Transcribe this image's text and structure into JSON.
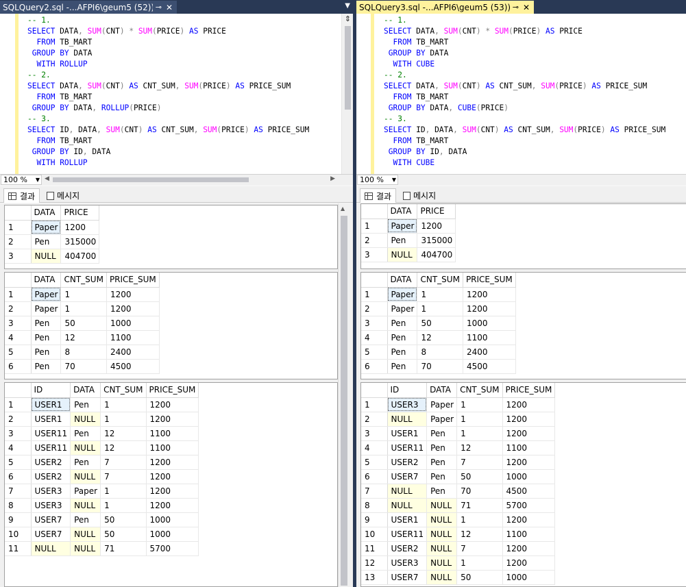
{
  "left": {
    "tab_title": "SQLQuery2.sql -...AFPI6\\geum5 (52))*",
    "pin_glyph": "⊸",
    "close_glyph": "✕",
    "zoom": "100 %",
    "results_tab": "결과",
    "messages_tab": "메시지",
    "code": [
      "-- 1.",
      "SELECT DATA, SUM(CNT) * SUM(PRICE) AS PRICE",
      "  FROM TB_MART",
      " GROUP BY DATA",
      "  WITH ROLLUP",
      "-- 2.",
      "SELECT DATA, SUM(CNT) AS CNT_SUM, SUM(PRICE) AS PRICE_SUM",
      "  FROM TB_MART",
      " GROUP BY DATA, ROLLUP(PRICE)",
      "-- 3.",
      "SELECT ID, DATA, SUM(CNT) AS CNT_SUM, SUM(PRICE) AS PRICE_SUM",
      "  FROM TB_MART",
      " GROUP BY ID, DATA",
      "  WITH ROLLUP"
    ],
    "grids": [
      {
        "columns": [
          "DATA",
          "PRICE"
        ],
        "rows": [
          [
            "1",
            "Paper",
            "1200"
          ],
          [
            "2",
            "Pen",
            "315000"
          ],
          [
            "3",
            "NULL",
            "404700"
          ]
        ]
      },
      {
        "columns": [
          "DATA",
          "CNT_SUM",
          "PRICE_SUM"
        ],
        "rows": [
          [
            "1",
            "Paper",
            "1",
            "1200"
          ],
          [
            "2",
            "Paper",
            "1",
            "1200"
          ],
          [
            "3",
            "Pen",
            "50",
            "1000"
          ],
          [
            "4",
            "Pen",
            "12",
            "1100"
          ],
          [
            "5",
            "Pen",
            "8",
            "2400"
          ],
          [
            "6",
            "Pen",
            "70",
            "4500"
          ]
        ]
      },
      {
        "columns": [
          "ID",
          "DATA",
          "CNT_SUM",
          "PRICE_SUM"
        ],
        "rows": [
          [
            "1",
            "USER1",
            "Pen",
            "1",
            "1200"
          ],
          [
            "2",
            "USER1",
            "NULL",
            "1",
            "1200"
          ],
          [
            "3",
            "USER11",
            "Pen",
            "12",
            "1100"
          ],
          [
            "4",
            "USER11",
            "NULL",
            "12",
            "1100"
          ],
          [
            "5",
            "USER2",
            "Pen",
            "7",
            "1200"
          ],
          [
            "6",
            "USER2",
            "NULL",
            "7",
            "1200"
          ],
          [
            "7",
            "USER3",
            "Paper",
            "1",
            "1200"
          ],
          [
            "8",
            "USER3",
            "NULL",
            "1",
            "1200"
          ],
          [
            "9",
            "USER7",
            "Pen",
            "50",
            "1000"
          ],
          [
            "10",
            "USER7",
            "NULL",
            "50",
            "1000"
          ],
          [
            "11",
            "NULL",
            "NULL",
            "71",
            "5700"
          ]
        ]
      }
    ]
  },
  "right": {
    "tab_title": "SQLQuery3.sql -...AFPI6\\geum5 (53))*",
    "pin_glyph": "⊸",
    "close_glyph": "✕",
    "zoom": "100 %",
    "results_tab": "결과",
    "messages_tab": "메시지",
    "code": [
      "-- 1.",
      "SELECT DATA, SUM(CNT) * SUM(PRICE) AS PRICE",
      "  FROM TB_MART",
      " GROUP BY DATA",
      "  WITH CUBE",
      "-- 2.",
      "SELECT DATA, SUM(CNT) AS CNT_SUM, SUM(PRICE) AS PRICE_SUM",
      "  FROM TB_MART",
      " GROUP BY DATA, CUBE(PRICE)",
      "-- 3.",
      "SELECT ID, DATA, SUM(CNT) AS CNT_SUM, SUM(PRICE) AS PRICE_SUM",
      "  FROM TB_MART",
      " GROUP BY ID, DATA",
      "  WITH CUBE"
    ],
    "grids": [
      {
        "columns": [
          "DATA",
          "PRICE"
        ],
        "rows": [
          [
            "1",
            "Paper",
            "1200"
          ],
          [
            "2",
            "Pen",
            "315000"
          ],
          [
            "3",
            "NULL",
            "404700"
          ]
        ]
      },
      {
        "columns": [
          "DATA",
          "CNT_SUM",
          "PRICE_SUM"
        ],
        "rows": [
          [
            "1",
            "Paper",
            "1",
            "1200"
          ],
          [
            "2",
            "Paper",
            "1",
            "1200"
          ],
          [
            "3",
            "Pen",
            "50",
            "1000"
          ],
          [
            "4",
            "Pen",
            "12",
            "1100"
          ],
          [
            "5",
            "Pen",
            "8",
            "2400"
          ],
          [
            "6",
            "Pen",
            "70",
            "4500"
          ]
        ]
      },
      {
        "columns": [
          "ID",
          "DATA",
          "CNT_SUM",
          "PRICE_SUM"
        ],
        "rows": [
          [
            "1",
            "USER3",
            "Paper",
            "1",
            "1200"
          ],
          [
            "2",
            "NULL",
            "Paper",
            "1",
            "1200"
          ],
          [
            "3",
            "USER1",
            "Pen",
            "1",
            "1200"
          ],
          [
            "4",
            "USER11",
            "Pen",
            "12",
            "1100"
          ],
          [
            "5",
            "USER2",
            "Pen",
            "7",
            "1200"
          ],
          [
            "6",
            "USER7",
            "Pen",
            "50",
            "1000"
          ],
          [
            "7",
            "NULL",
            "Pen",
            "70",
            "4500"
          ],
          [
            "8",
            "NULL",
            "NULL",
            "71",
            "5700"
          ],
          [
            "9",
            "USER1",
            "NULL",
            "1",
            "1200"
          ],
          [
            "10",
            "USER11",
            "NULL",
            "12",
            "1100"
          ],
          [
            "11",
            "USER2",
            "NULL",
            "7",
            "1200"
          ],
          [
            "12",
            "USER3",
            "NULL",
            "1",
            "1200"
          ],
          [
            "13",
            "USER7",
            "NULL",
            "50",
            "1000"
          ]
        ]
      }
    ]
  },
  "colors": {
    "null_cell": "#ffffe1",
    "keyword": "#0000ff",
    "function": "#ff00ff",
    "comment": "#008000",
    "active_tab": "#fff29d",
    "inactive_tab": "#3c4f71"
  }
}
